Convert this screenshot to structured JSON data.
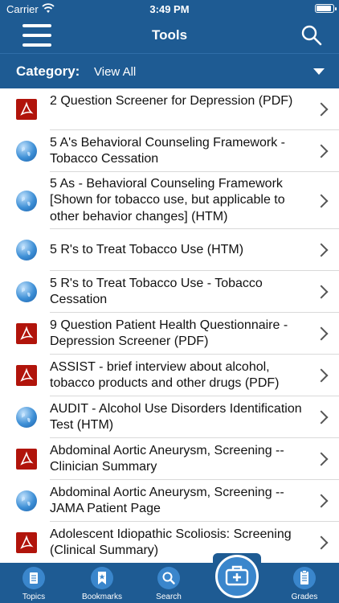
{
  "status": {
    "carrier": "Carrier",
    "time": "3:49 PM"
  },
  "nav": {
    "title": "Tools"
  },
  "category": {
    "label": "Category:",
    "value": "View All"
  },
  "items": [
    {
      "text": "2 Question Screener for Depression (PDF)",
      "type": "pdf"
    },
    {
      "text": "5 A's Behavioral Counseling Framework - Tobacco Cessation",
      "type": "web"
    },
    {
      "text": "5 As - Behavioral Counseling Framework [Shown for tobacco use, but applicable to other behavior changes] (HTM)",
      "type": "web"
    },
    {
      "text": "5 R's to Treat Tobacco Use (HTM)",
      "type": "web"
    },
    {
      "text": "5 R's to Treat Tobacco Use - Tobacco Cessation",
      "type": "web"
    },
    {
      "text": "9 Question Patient Health Questionnaire - Depression Screener (PDF)",
      "type": "pdf"
    },
    {
      "text": "ASSIST - brief interview about alcohol, tobacco products and other drugs (PDF)",
      "type": "pdf"
    },
    {
      "text": "AUDIT - Alcohol Use Disorders Identification Test (HTM)",
      "type": "web"
    },
    {
      "text": "Abdominal Aortic Aneurysm, Screening -- Clinician Summary",
      "type": "pdf"
    },
    {
      "text": "Abdominal Aortic Aneurysm, Screening -- JAMA Patient Page",
      "type": "web"
    },
    {
      "text": "Adolescent Idiopathic Scoliosis: Screening (Clinical Summary)",
      "type": "pdf"
    }
  ],
  "tabs": {
    "topics": "Topics",
    "bookmarks": "Bookmarks",
    "search": "Search",
    "grades": "Grades"
  },
  "icons": {
    "pdf": "pdf-icon",
    "web": "globe-icon",
    "center_tab": "medical-kit-icon"
  },
  "colors": {
    "brand": "#1e5b93",
    "accent": "#3a86cc",
    "pdf": "#b1140b"
  }
}
